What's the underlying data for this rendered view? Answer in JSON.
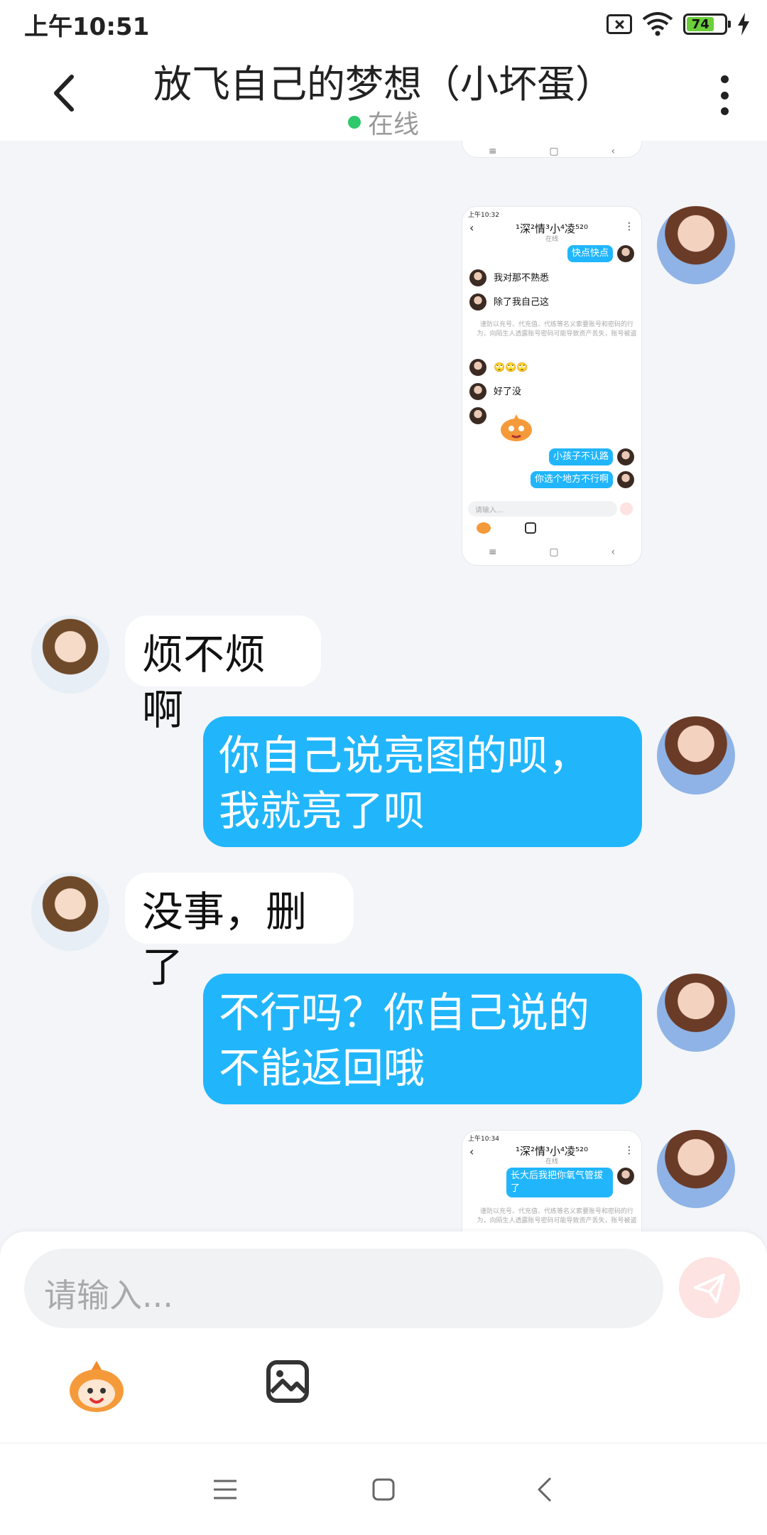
{
  "status_bar": {
    "time": "上午10:51",
    "battery": "74"
  },
  "header": {
    "title": "放飞自己的梦想（小坏蛋）",
    "status": "在线"
  },
  "screenshot_1": {
    "time": "上午10:32",
    "title": "¹深²情³小⁴凌⁵²⁰",
    "status": "在线",
    "msg_out_1": "快点快点",
    "msg_in_1": "我对那不熟悉",
    "msg_in_2": "除了我自己这",
    "notice": "谨防以充号、代充值、代练等名义索要账号和密码的行为，向陌生人透露账号密码可能导致资产丢失，账号被盗",
    "msg_in_3": "🙄🙄🙄",
    "msg_in_4": "好了没",
    "msg_out_2": "小孩子不认路",
    "msg_out_3": "你选个地方不行啊",
    "input_placeholder": "请输入..."
  },
  "messages": [
    {
      "text": "烦不烦啊"
    },
    {
      "text": "你自己说亮图的呗，我就亮了呗"
    },
    {
      "text": "没事，删了"
    },
    {
      "text": "不行吗？你自己说的不能返回哦"
    }
  ],
  "screenshot_2": {
    "time": "上午10:34",
    "title": "¹深²情³小⁴凌⁵²⁰",
    "status": "在线",
    "msg_out_1": "长大后我把你氧气管拔了",
    "notice": "谨防以充号、代充值、代练等名义索要账号和密码的行为，向陌生人透露账号密码可能导致资产丢失，账号被盗"
  },
  "composer": {
    "placeholder": "请输入..."
  }
}
